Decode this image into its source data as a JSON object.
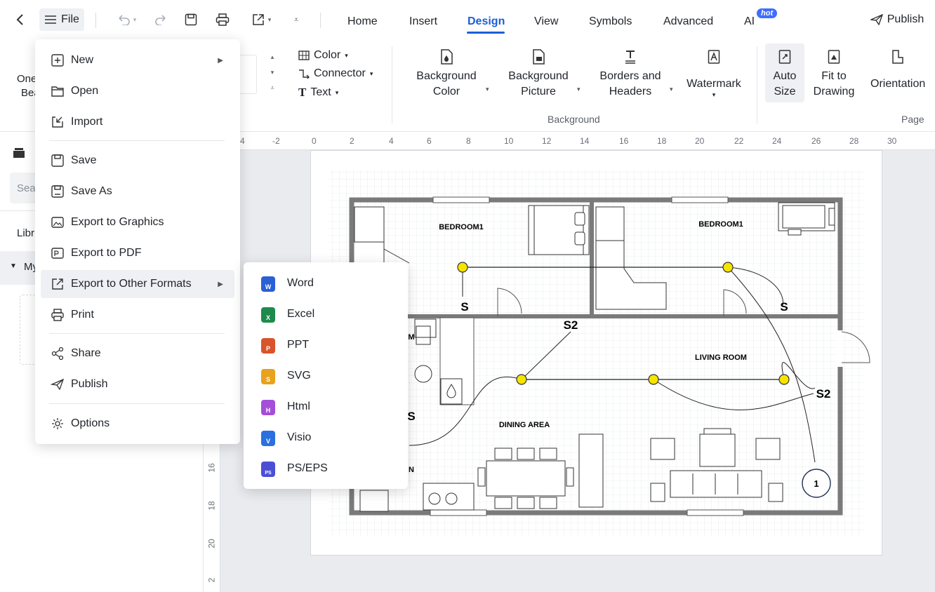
{
  "topbar": {
    "file_label": "File",
    "tabs": [
      {
        "label": "Home"
      },
      {
        "label": "Insert"
      },
      {
        "label": "Design"
      },
      {
        "label": "View"
      },
      {
        "label": "Symbols"
      },
      {
        "label": "Advanced"
      },
      {
        "label": "AI"
      }
    ],
    "hot_badge": "hot",
    "publish_label": "Publish"
  },
  "ribbon": {
    "left_partial_1": "One",
    "left_partial_2": "Bea",
    "color_label": "Color",
    "connector_label": "Connector",
    "text_label": "Text",
    "background_color_1": "Background",
    "background_color_2": "Color",
    "background_picture_1": "Background",
    "background_picture_2": "Picture",
    "borders_1": "Borders and",
    "borders_2": "Headers",
    "watermark": "Watermark",
    "auto_size_1": "Auto",
    "auto_size_2": "Size",
    "fit_1": "Fit to",
    "fit_2": "Drawing",
    "orientation": "Orientation",
    "group_background": "Background",
    "group_page": "Page"
  },
  "left_panel": {
    "search_partial": "Sea",
    "library_partial": "Libr",
    "my_partial": "My"
  },
  "ruler": {
    "top_ticks": [
      "4",
      "-2",
      "0",
      "2",
      "4",
      "6",
      "8",
      "10",
      "12",
      "14",
      "16",
      "18",
      "20",
      "22",
      "24",
      "26",
      "28",
      "30"
    ],
    "left_ticks": [
      "16",
      "18",
      "20",
      "2"
    ]
  },
  "file_menu": {
    "items": [
      {
        "label": "New",
        "icon": "plus-square-icon",
        "has_submenu": true
      },
      {
        "label": "Open",
        "icon": "folder-icon"
      },
      {
        "label": "Import",
        "icon": "import-icon"
      },
      {
        "label": "Save",
        "icon": "save-icon"
      },
      {
        "label": "Save As",
        "icon": "save-as-icon"
      },
      {
        "label": "Export to Graphics",
        "icon": "image-export-icon"
      },
      {
        "label": "Export to PDF",
        "icon": "pdf-export-icon"
      },
      {
        "label": "Export to Other Formats",
        "icon": "export-icon",
        "has_submenu": true
      },
      {
        "label": "Print",
        "icon": "printer-icon"
      },
      {
        "label": "Share",
        "icon": "share-icon"
      },
      {
        "label": "Publish",
        "icon": "send-icon"
      },
      {
        "label": "Options",
        "icon": "gear-icon"
      }
    ]
  },
  "export_submenu": {
    "items": [
      {
        "label": "Word",
        "badge": "W",
        "color": "#2b5fd6"
      },
      {
        "label": "Excel",
        "badge": "X",
        "color": "#1e8a4c"
      },
      {
        "label": "PPT",
        "badge": "P",
        "color": "#d9532b"
      },
      {
        "label": "SVG",
        "badge": "S",
        "color": "#e8a21c"
      },
      {
        "label": "Html",
        "badge": "H",
        "color": "#a34fd9"
      },
      {
        "label": "Visio",
        "badge": "V",
        "color": "#2b6fe0"
      },
      {
        "label": "PS/EPS",
        "badge": "PS",
        "color": "#4b4fd6"
      }
    ]
  },
  "floorplan": {
    "bedroom1_left": "BEDROOM1",
    "bedroom1_right": "BEDROOM1",
    "living_room": "LIVING ROOM",
    "dining_area": "DINING AREA",
    "switch_s_left": "S",
    "switch_s_right": "S",
    "switch_s2_top": "S2",
    "switch_s2_right": "S2",
    "partial_m": "M",
    "partial_s": "S",
    "partial_n": "N",
    "panel_number": "1"
  },
  "colors": {
    "accent": "#1b5fd6",
    "hot_badge": "#3f6dff",
    "light_fixture": "#f5e400",
    "wall": "#7a7a7a"
  }
}
